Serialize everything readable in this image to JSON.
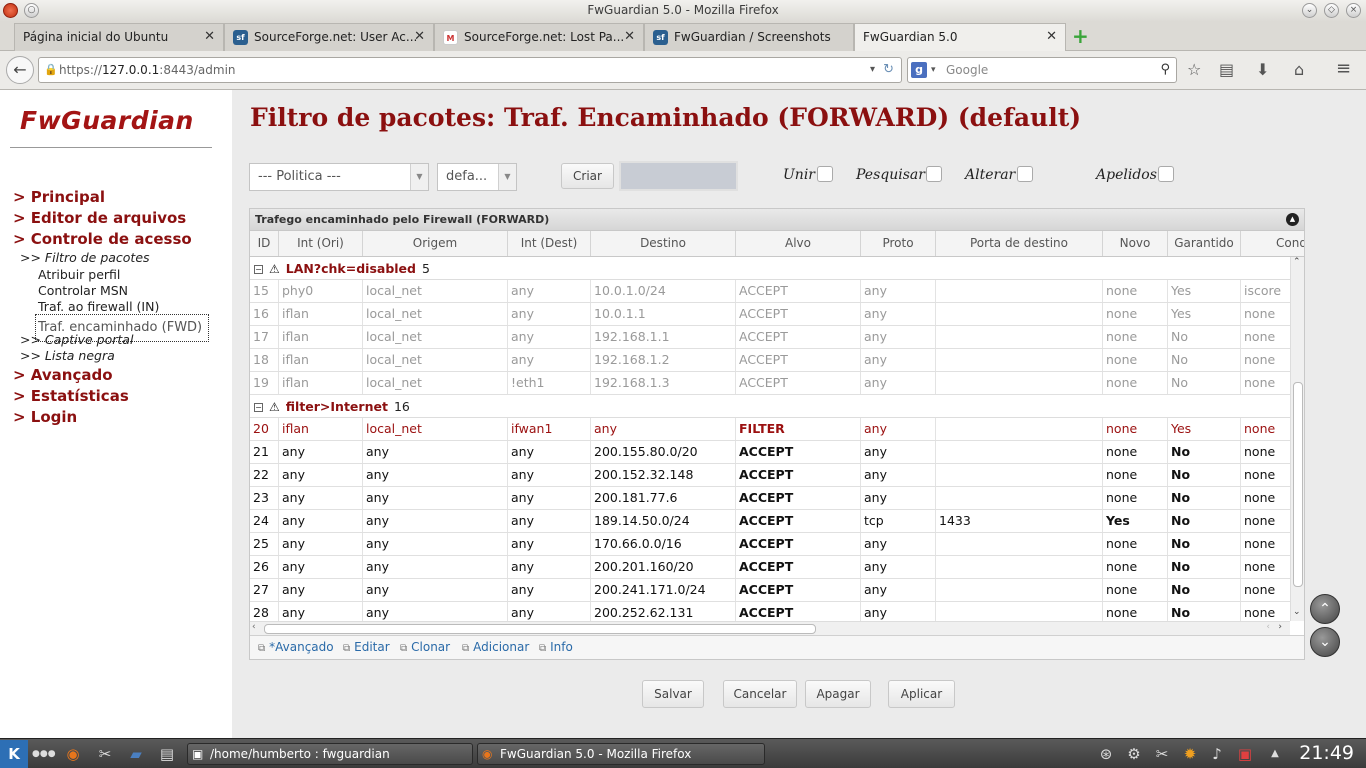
{
  "window": {
    "title": "FwGuardian 5.0 - Mozilla Firefox"
  },
  "tabs": [
    {
      "label": "Página inicial do Ubuntu",
      "icon": ""
    },
    {
      "label": "SourceForge.net: User Ac...",
      "icon": "sf"
    },
    {
      "label": "SourceForge.net: Lost Pa...",
      "icon": "M"
    },
    {
      "label": "FwGuardian / Screenshots",
      "icon": "sf"
    },
    {
      "label": "FwGuardian 5.0",
      "icon": ""
    }
  ],
  "nav": {
    "url_host": "127.0.0.1",
    "url_prefix": "https://",
    "url_path": ":8443/admin",
    "search_placeholder": "Google"
  },
  "sidebar": {
    "logo": "FwGuardian",
    "items": [
      {
        "label": "> Principal",
        "level": 1
      },
      {
        "label": "> Editor de arquivos",
        "level": 1
      },
      {
        "label": "> Controle de acesso",
        "level": 1
      },
      {
        "label": ">> Filtro de pacotes",
        "level": 2
      },
      {
        "label": "Atribuir perfil",
        "level": 3
      },
      {
        "label": "Controlar MSN",
        "level": 3
      },
      {
        "label": "Traf. ao firewall (IN)",
        "level": 3
      },
      {
        "label": "Traf. encaminhado (FWD)",
        "level": 3,
        "selected": true
      },
      {
        "label": ">> Captive portal",
        "level": 2
      },
      {
        "label": ">> Lista negra",
        "level": 2
      },
      {
        "label": "> Avançado",
        "level": 1
      },
      {
        "label": "> Estatísticas",
        "level": 1
      },
      {
        "label": "> Login",
        "level": 1
      }
    ]
  },
  "main": {
    "title": "Filtro de pacotes: Traf. Encaminhado (FORWARD) (default)",
    "policy_select": "--- Politica ---",
    "profile_select": "defa...",
    "create_button": "Criar",
    "create_input": "",
    "checks": [
      "Unir",
      "Pesquisar",
      "Alterar",
      "Apelidos"
    ]
  },
  "grid": {
    "caption": "Trafego encaminhado pelo Firewall (FORWARD)",
    "columns": [
      "ID",
      "Int (Ori)",
      "Origem",
      "Int (Dest)",
      "Destino",
      "Alvo",
      "Proto",
      "Porta de destino",
      "Novo",
      "Garantido",
      "Cond"
    ],
    "groups": [
      {
        "name": "LAN?chk=disabled",
        "count": "5",
        "style": "dis",
        "rows": [
          [
            "15",
            "phy0",
            "local_net",
            "any",
            "10.0.1.0/24",
            "ACCEPT",
            "any",
            "",
            "none",
            "Yes",
            "iscore"
          ],
          [
            "16",
            "iflan",
            "local_net",
            "any",
            "10.0.1.1",
            "ACCEPT",
            "any",
            "",
            "none",
            "Yes",
            "none"
          ],
          [
            "17",
            "iflan",
            "local_net",
            "any",
            "192.168.1.1",
            "ACCEPT",
            "any",
            "",
            "none",
            "No",
            "none"
          ],
          [
            "18",
            "iflan",
            "local_net",
            "any",
            "192.168.1.2",
            "ACCEPT",
            "any",
            "",
            "none",
            "No",
            "none"
          ],
          [
            "19",
            "iflan",
            "local_net",
            "!eth1",
            "192.168.1.3",
            "ACCEPT",
            "any",
            "",
            "none",
            "No",
            "none"
          ]
        ]
      },
      {
        "name": "filter>Internet",
        "count": "16",
        "style": "norm",
        "rows": [
          [
            "20",
            "iflan",
            "local_net",
            "ifwan1",
            "any",
            "FILTER",
            "any",
            "",
            "none",
            "Yes",
            "none"
          ],
          [
            "21",
            "any",
            "any",
            "any",
            "200.155.80.0/20",
            "ACCEPT",
            "any",
            "",
            "none",
            "No",
            "none"
          ],
          [
            "22",
            "any",
            "any",
            "any",
            "200.152.32.148",
            "ACCEPT",
            "any",
            "",
            "none",
            "No",
            "none"
          ],
          [
            "23",
            "any",
            "any",
            "any",
            "200.181.77.6",
            "ACCEPT",
            "any",
            "",
            "none",
            "No",
            "none"
          ],
          [
            "24",
            "any",
            "any",
            "any",
            "189.14.50.0/24",
            "ACCEPT",
            "tcp",
            "1433",
            "Yes",
            "No",
            "none"
          ],
          [
            "25",
            "any",
            "any",
            "any",
            "170.66.0.0/16",
            "ACCEPT",
            "any",
            "",
            "none",
            "No",
            "none"
          ],
          [
            "26",
            "any",
            "any",
            "any",
            "200.201.160/20",
            "ACCEPT",
            "any",
            "",
            "none",
            "No",
            "none"
          ],
          [
            "27",
            "any",
            "any",
            "any",
            "200.241.171.0/24",
            "ACCEPT",
            "any",
            "",
            "none",
            "No",
            "none"
          ],
          [
            "28",
            "any",
            "any",
            "any",
            "200.252.62.131",
            "ACCEPT",
            "any",
            "",
            "none",
            "No",
            "none"
          ]
        ]
      }
    ],
    "footer_links": [
      "*Avançado",
      "Editar",
      "Clonar",
      "Adicionar",
      "Info"
    ]
  },
  "actions": [
    "Salvar",
    "Cancelar",
    "Apagar",
    "Aplicar"
  ],
  "taskbar": {
    "tasks": [
      "/home/humberto : fwguardian",
      "FwGuardian 5.0 - Mozilla Firefox"
    ],
    "clock": "21:49"
  },
  "colors": {
    "brand": "#8b1010",
    "link": "#2a6aa8",
    "yes": "#1a7a1a",
    "no": "#bb0000"
  }
}
